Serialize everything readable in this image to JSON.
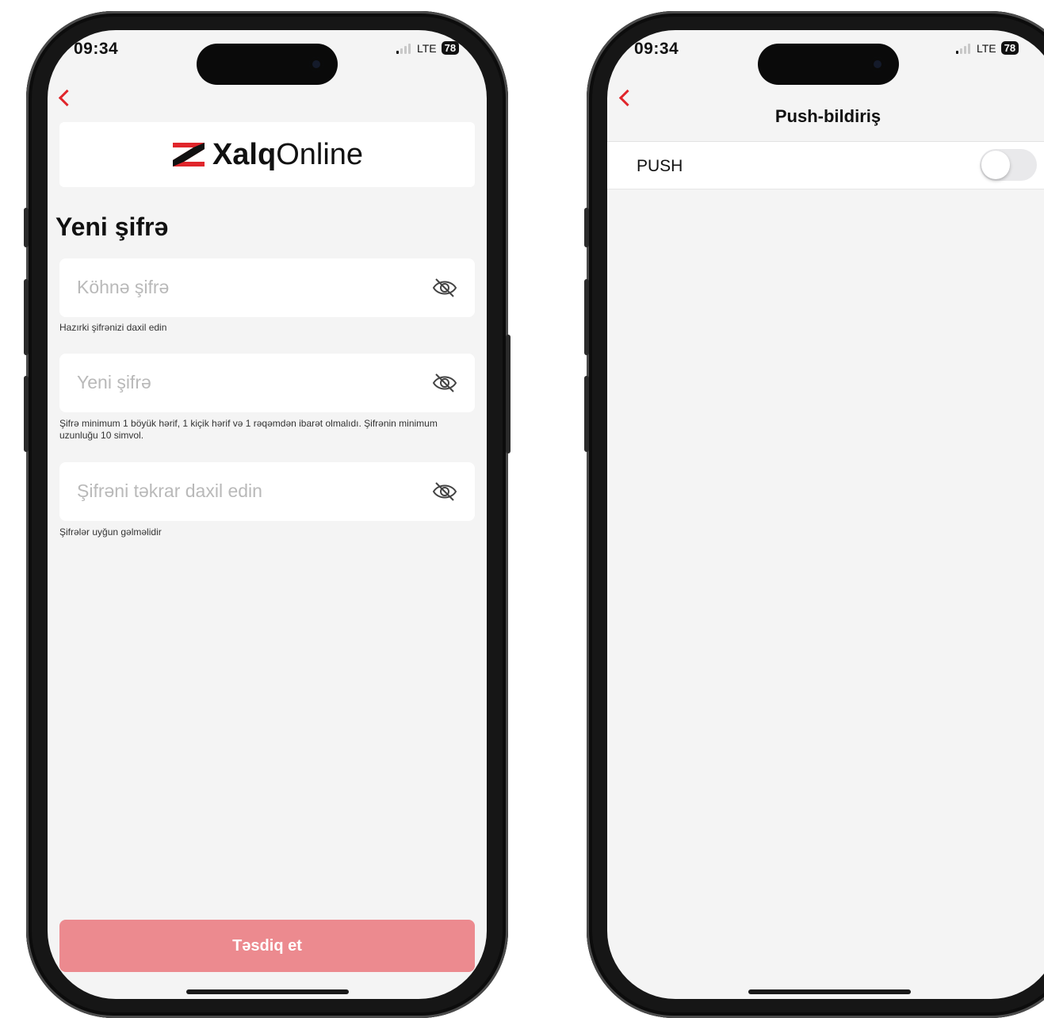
{
  "status_bar": {
    "time": "09:34",
    "network": "LTE",
    "battery": "78"
  },
  "password_screen": {
    "back_icon": "chevron-left-icon",
    "logo": {
      "bold": "Xalq",
      "regular": "Online"
    },
    "title": "Yeni şifrə",
    "fields": [
      {
        "placeholder": "Köhnə şifrə",
        "hint": "Hazırki şifrənizi daxil edin",
        "icon": "eye-off-icon"
      },
      {
        "placeholder": "Yeni şifrə",
        "hint": "Şifrə minimum 1 böyük hərif, 1 kiçik hərif və 1 rəqəmdən ibarət olmalıdı. Şifrənin minimum uzunluğu 10 simvol.",
        "icon": "eye-off-icon"
      },
      {
        "placeholder": "Şifrəni təkrar daxil edin",
        "hint": "Şifrələr uyğun gəlməlidir",
        "icon": "eye-off-icon"
      }
    ],
    "confirm_label": "Təsdiq et"
  },
  "push_screen": {
    "back_icon": "chevron-left-icon",
    "title": "Push-bildiriş",
    "row_label": "PUSH",
    "toggle_on": false
  },
  "colors": {
    "accent": "#e0262c",
    "button_disabled": "#ec8a8f",
    "screen_bg": "#f4f4f4"
  }
}
